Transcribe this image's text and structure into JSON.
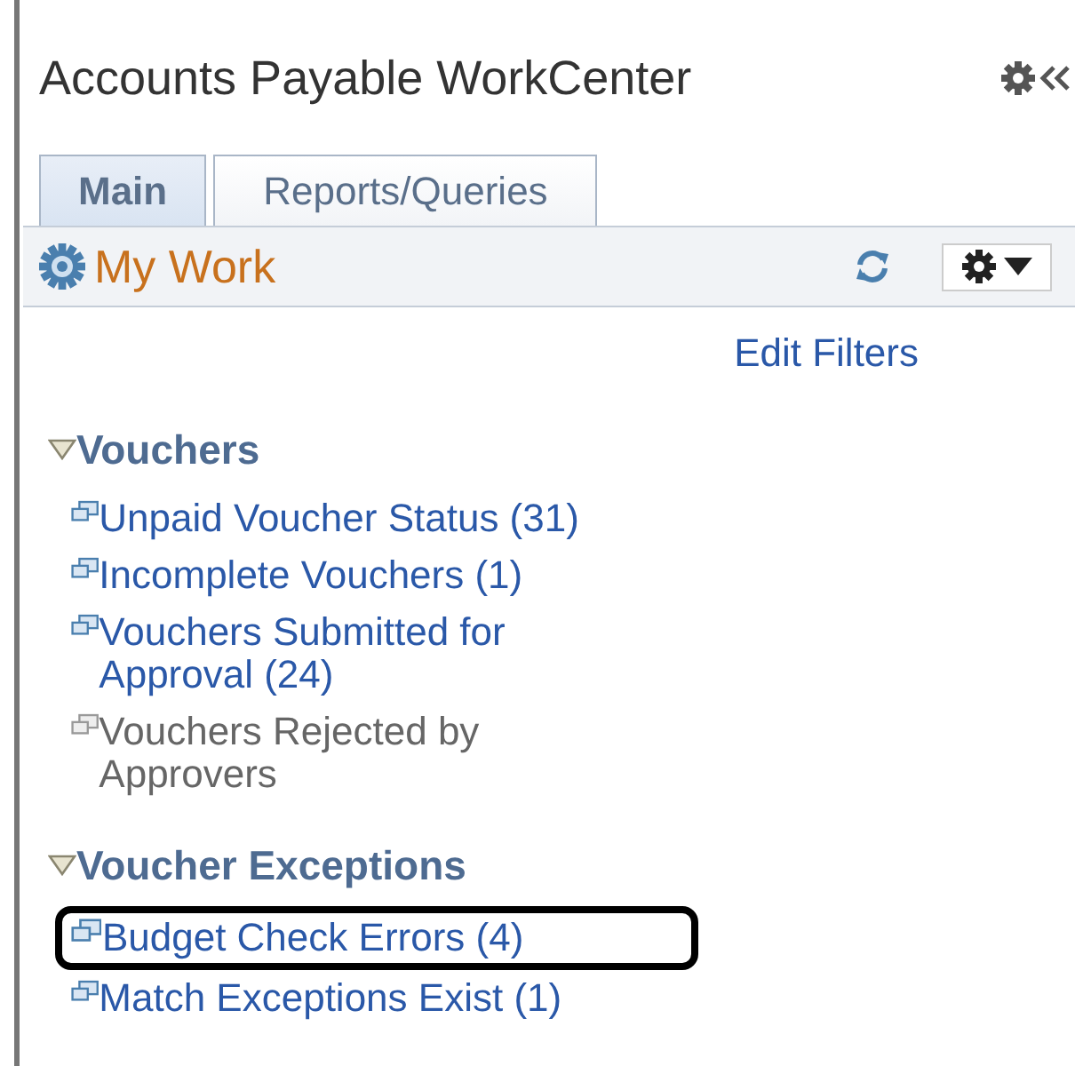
{
  "header": {
    "title": "Accounts Payable WorkCenter"
  },
  "tabs": [
    {
      "label": "Main",
      "selected": true
    },
    {
      "label": "Reports/Queries",
      "selected": false
    }
  ],
  "pagelet": {
    "title": "My Work",
    "link": "Edit Filters"
  },
  "sections": [
    {
      "title": "Vouchers",
      "expanded": true,
      "items": [
        {
          "label": "Unpaid Voucher Status (31)",
          "disabled": false,
          "highlighted": false
        },
        {
          "label": "Incomplete Vouchers (1)",
          "disabled": false,
          "highlighted": false
        },
        {
          "label": "Vouchers Submitted for Approval (24)",
          "disabled": false,
          "highlighted": false
        },
        {
          "label": "Vouchers Rejected by Approvers",
          "disabled": true,
          "highlighted": false
        }
      ]
    },
    {
      "title": "Voucher Exceptions",
      "expanded": true,
      "items": [
        {
          "label": "Budget Check Errors (4)",
          "disabled": false,
          "highlighted": true
        },
        {
          "label": "Match Exceptions Exist (1)",
          "disabled": false,
          "highlighted": false
        }
      ]
    }
  ]
}
